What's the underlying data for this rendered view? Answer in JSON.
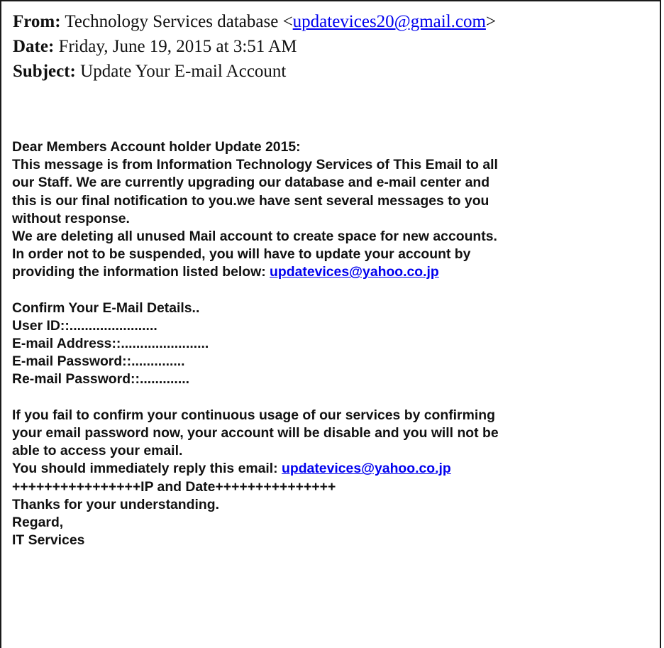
{
  "header": {
    "from_label": "From:",
    "from_name": "Technology Services database",
    "from_open": "<",
    "from_email": "updatevices20@gmail.com",
    "from_close": ">",
    "date_label": "Date:",
    "date_value": "Friday, June 19, 2015 at 3:51 AM",
    "subject_label": "Subject:",
    "subject_value": "Update Your E-mail Account"
  },
  "body": {
    "p1": [
      "Dear Members Account holder Update 2015:",
      "This message is from Information Technology Services of This Email to all",
      "our Staff. We are currently upgrading our database and e-mail center and",
      "this is our final notification to you.we have sent several messages to you",
      "without response.",
      "We are deleting all unused Mail account to create space for new accounts.",
      "In order not to be suspended, you will have to update your account by"
    ],
    "p1_last_prefix": "providing the information listed below:",
    "p1_link": "updatevices@yahoo.co.jp",
    "p2": [
      "Confirm Your E-Mail Details..",
      "User ID::.......................",
      "E-mail Address::.......................",
      "E-mail Password::..............",
      "Re-mail Password::............."
    ],
    "p3": [
      "If you fail to confirm your continuous usage of our services by confirming",
      "your email password now, your account will be disable and you will not be",
      "able to access your email."
    ],
    "reply_prefix": "You should immediately reply this email:",
    "reply_link": "updatevices@yahoo.co.jp",
    "ip_line": "++++++++++++++++IP and Date+++++++++++++++",
    "closing": [
      "Thanks for your understanding.",
      "Regard,",
      "IT Services"
    ]
  }
}
